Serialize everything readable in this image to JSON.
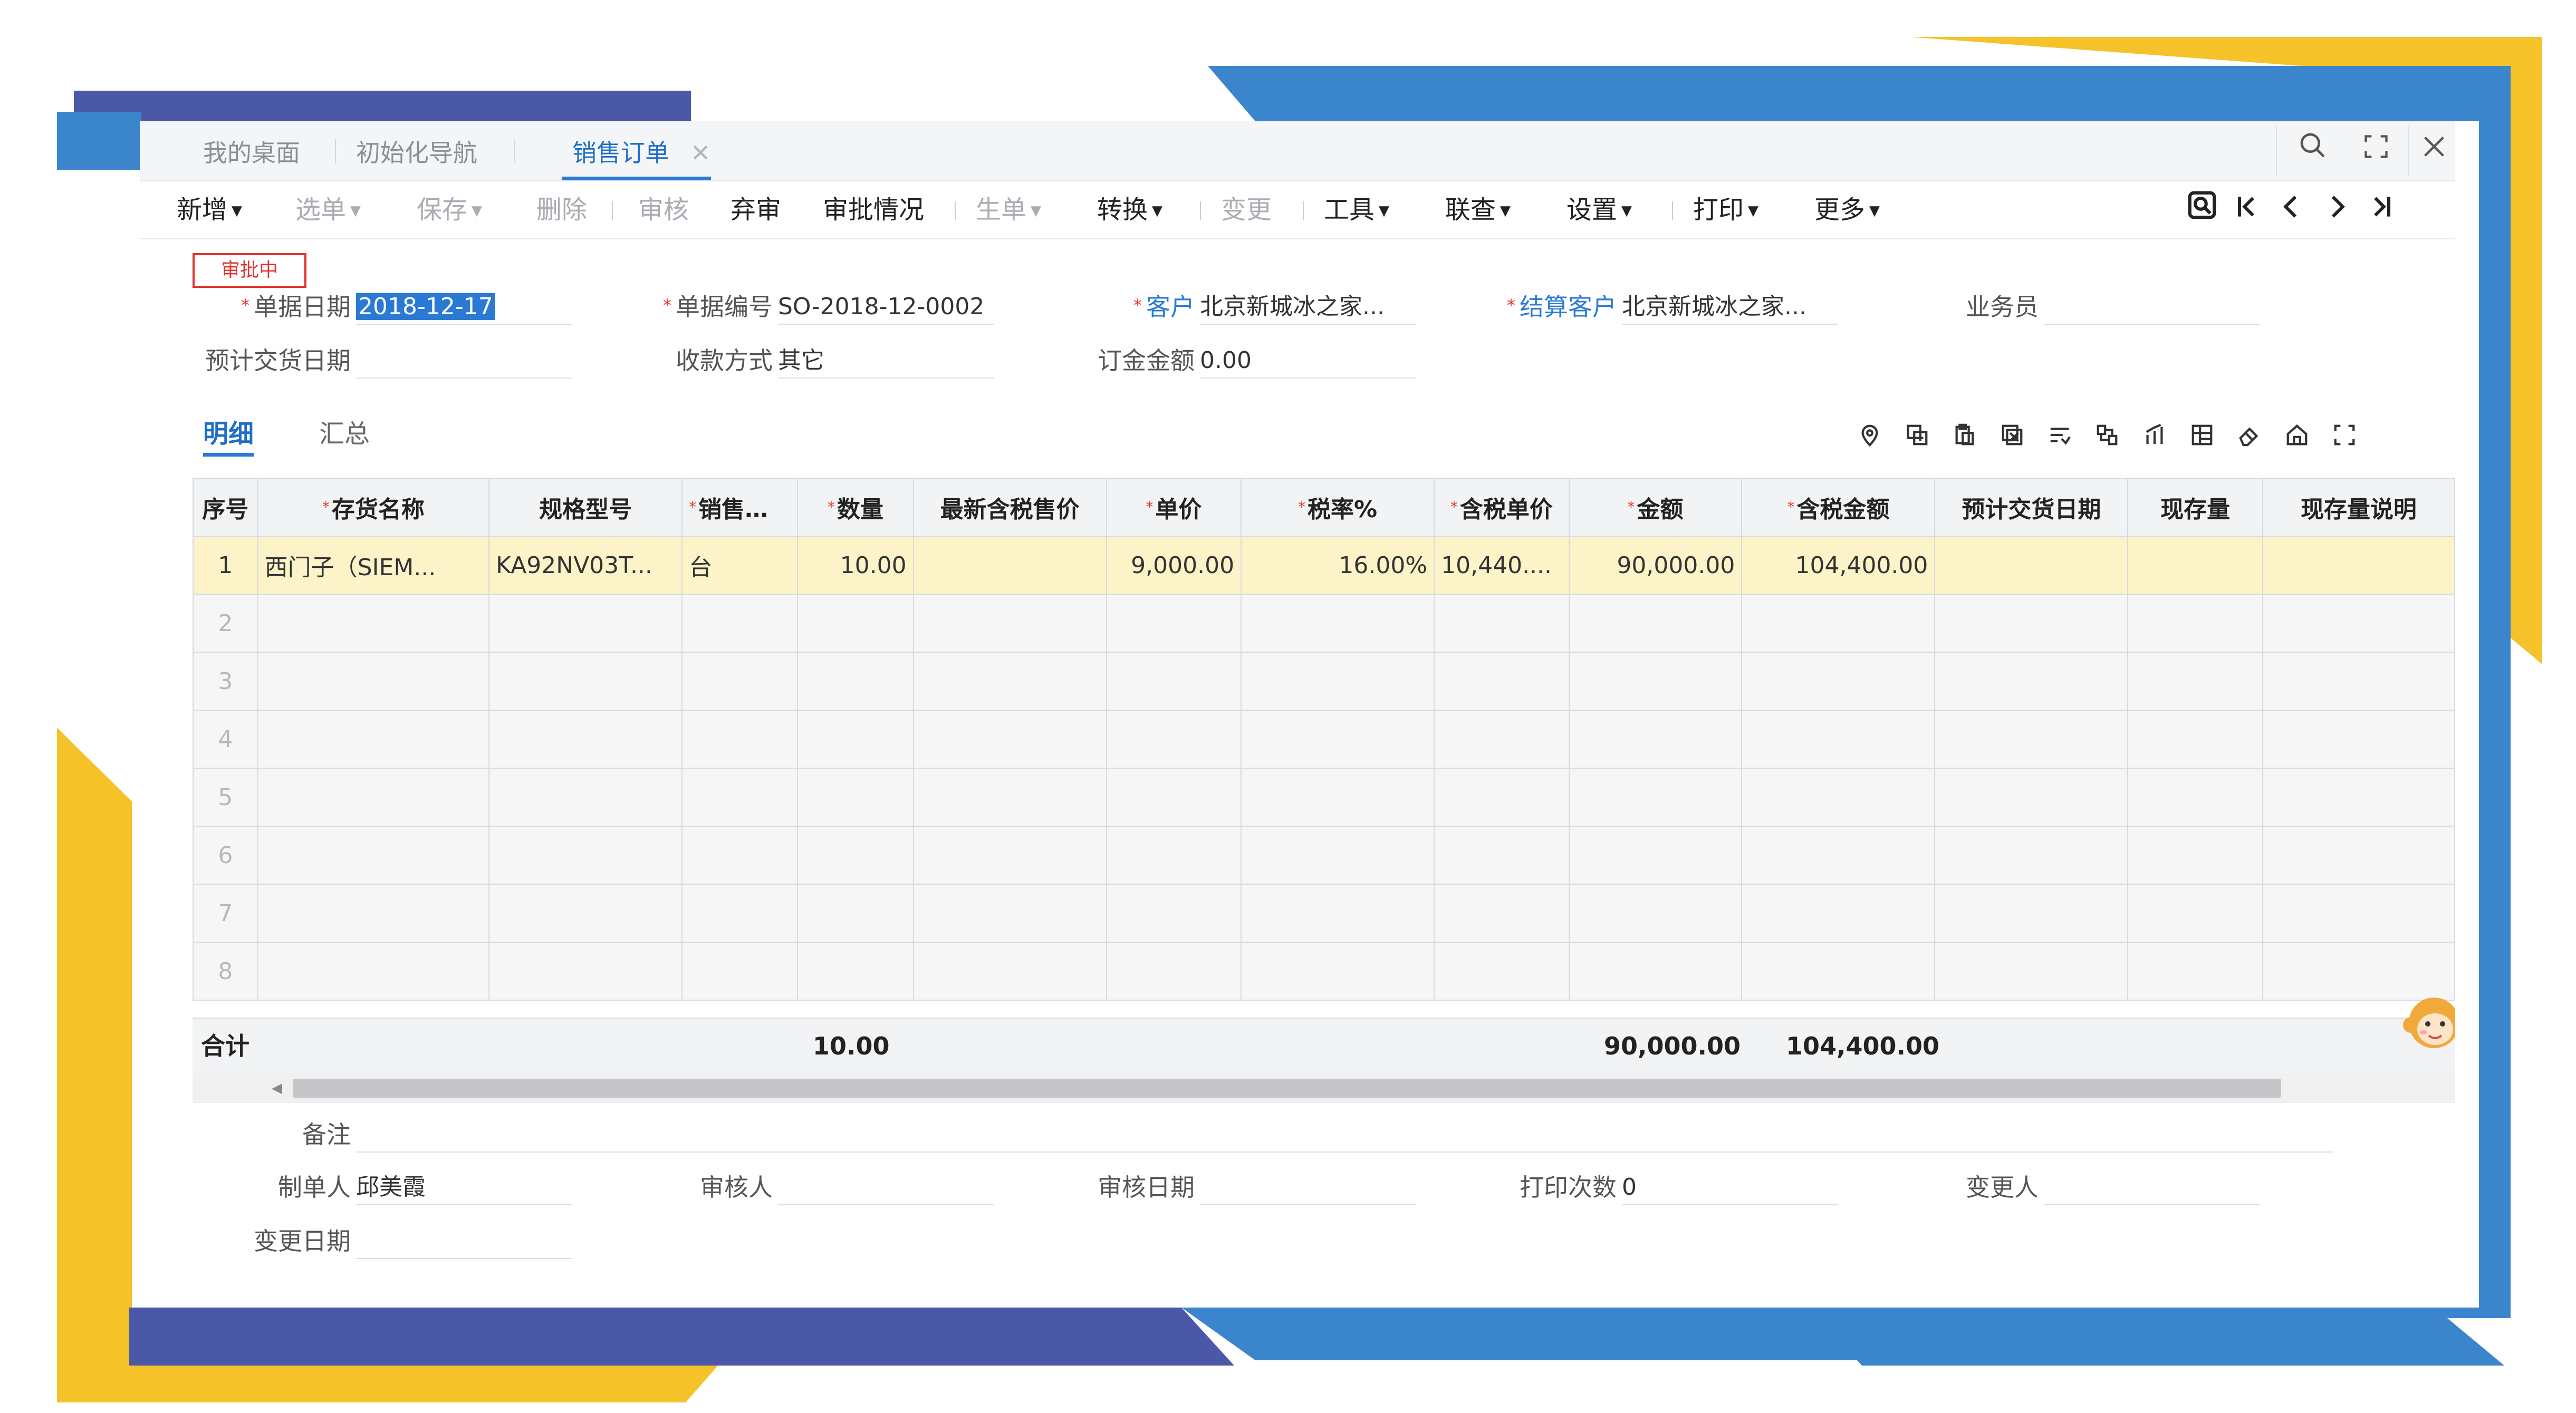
{
  "colors": {
    "blue": "#3a85cc",
    "yellow": "#f5c22a",
    "purple": "#4b58a8",
    "accent": "#2a7ad5",
    "required": "#e0352c",
    "row_highlight": "#fcf4c8"
  },
  "tabs": [
    {
      "label": "我的桌面"
    },
    {
      "label": "初始化导航"
    },
    {
      "label": "销售订单",
      "active": true,
      "close": "✕"
    }
  ],
  "window_controls": {
    "search": "search-icon",
    "maximize": "maximize-icon",
    "close": "close-icon"
  },
  "toolbar": {
    "new": "新增",
    "choose": "选单",
    "save": "保存",
    "delete": "删除",
    "audit": "审核",
    "abandon_audit": "弃审",
    "approval_status": "审批情况",
    "generate": "生单",
    "convert": "转换",
    "change": "变更",
    "tools": "工具",
    "query": "联查",
    "settings": "设置",
    "print": "打印",
    "more": "更多"
  },
  "nav_icons": [
    "locate-icon",
    "first-icon",
    "prev-icon",
    "next-icon",
    "last-icon"
  ],
  "status_badge": "审批中",
  "header": {
    "doc_date_label": "单据日期",
    "doc_date": "2018-12-17",
    "doc_no_label": "单据编号",
    "doc_no": "SO-2018-12-0002",
    "customer_label": "客户",
    "customer": "北京新城冰之家...",
    "settle_customer_label": "结算客户",
    "settle_customer": "北京新城冰之家...",
    "salesman_label": "业务员",
    "salesman": "",
    "delivery_date_label": "预计交货日期",
    "delivery_date": "",
    "payment_label": "收款方式",
    "payment": "其它",
    "deposit_label": "订金金额",
    "deposit": "0.00"
  },
  "sub_tabs": {
    "detail": "明细",
    "summary": "汇总"
  },
  "grid_icons": [
    "location-icon",
    "copy-row-icon",
    "paste-icon",
    "delete-row-icon",
    "sort-icon",
    "split-icon",
    "chart-icon",
    "table-icon",
    "eraser-icon",
    "home-icon",
    "fullscreen-icon"
  ],
  "grid": {
    "columns": [
      {
        "label": "序号",
        "required": false
      },
      {
        "label": "存货名称",
        "required": true
      },
      {
        "label": "规格型号",
        "required": false
      },
      {
        "label": "销售单位",
        "required": true
      },
      {
        "label": "数量",
        "required": true
      },
      {
        "label": "最新含税售价",
        "required": false
      },
      {
        "label": "单价",
        "required": true
      },
      {
        "label": "税率%",
        "required": true
      },
      {
        "label": "含税单价",
        "required": true
      },
      {
        "label": "金额",
        "required": true
      },
      {
        "label": "含税金额",
        "required": true
      },
      {
        "label": "预计交货日期",
        "required": false
      },
      {
        "label": "现存量",
        "required": false
      },
      {
        "label": "现存量说明",
        "required": false
      }
    ],
    "rows": [
      [
        "1",
        "西门子（SIEM...",
        "KA92NV03T...",
        "台",
        "10.00",
        "",
        "9,000.00",
        "16.00%",
        "10,440....",
        "90,000.00",
        "104,400.00",
        "",
        "",
        ""
      ],
      [
        "2",
        "",
        "",
        "",
        "",
        "",
        "",
        "",
        "",
        "",
        "",
        "",
        "",
        ""
      ],
      [
        "3",
        "",
        "",
        "",
        "",
        "",
        "",
        "",
        "",
        "",
        "",
        "",
        "",
        ""
      ],
      [
        "4",
        "",
        "",
        "",
        "",
        "",
        "",
        "",
        "",
        "",
        "",
        "",
        "",
        ""
      ],
      [
        "5",
        "",
        "",
        "",
        "",
        "",
        "",
        "",
        "",
        "",
        "",
        "",
        "",
        ""
      ],
      [
        "6",
        "",
        "",
        "",
        "",
        "",
        "",
        "",
        "",
        "",
        "",
        "",
        "",
        ""
      ],
      [
        "7",
        "",
        "",
        "",
        "",
        "",
        "",
        "",
        "",
        "",
        "",
        "",
        "",
        ""
      ],
      [
        "8",
        "",
        "",
        "",
        "",
        "",
        "",
        "",
        "",
        "",
        "",
        "",
        "",
        ""
      ]
    ]
  },
  "totals": {
    "label": "合计",
    "quantity": "10.00",
    "amount": "90,000.00",
    "tax_amount": "104,400.00"
  },
  "footer": {
    "remark_label": "备注",
    "remark": "",
    "maker_label": "制单人",
    "maker": "邱美霞",
    "auditor_label": "审核人",
    "auditor": "",
    "audit_date_label": "审核日期",
    "audit_date": "",
    "print_count_label": "打印次数",
    "print_count": "0",
    "changer_label": "变更人",
    "changer": "",
    "change_date_label": "变更日期",
    "change_date": ""
  }
}
